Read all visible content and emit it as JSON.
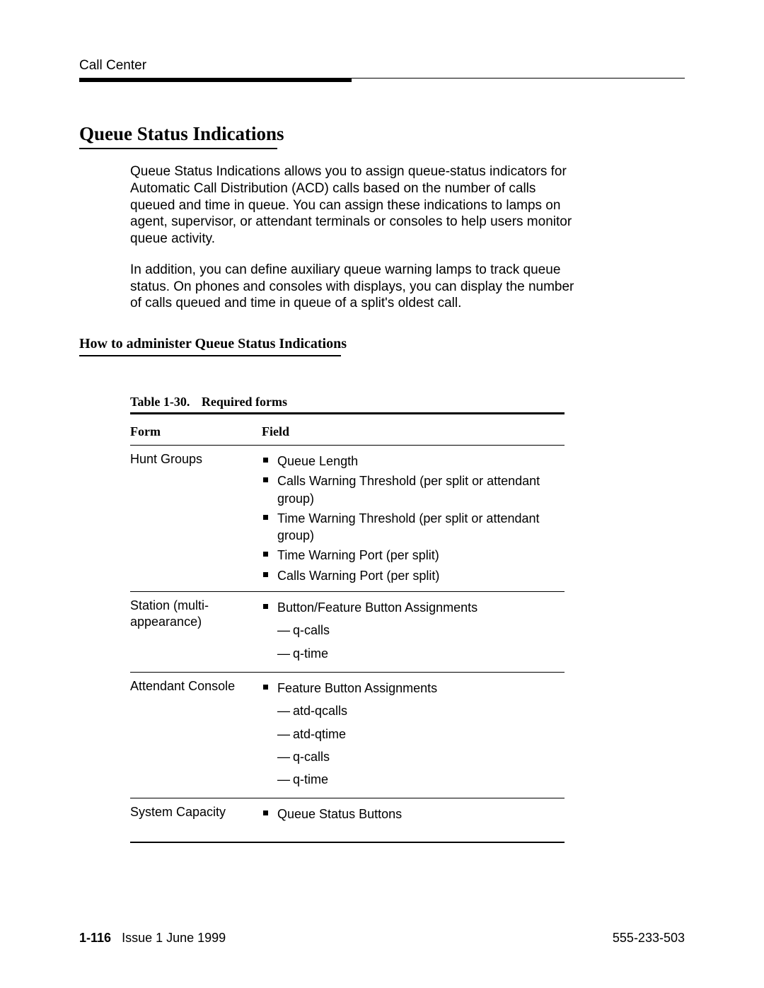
{
  "header": {
    "running": "Call Center"
  },
  "title": "Queue Status Indications",
  "paragraphs": {
    "p1": "Queue Status Indications allows you to assign queue-status indicators for Automatic Call Distribution (ACD) calls based on the number of calls queued and time in queue. You can assign these indications to lamps on agent, supervisor, or attendant terminals or consoles to help users monitor queue activity.",
    "p2": "In addition, you can define auxiliary queue warning lamps to track queue status. On phones and consoles with displays, you can display the number of calls queued and time in queue of a split's oldest call."
  },
  "subhead": "How to administer Queue Status Indications",
  "table": {
    "caption_no": "Table 1-30.",
    "caption_title": "Required forms",
    "headers": {
      "form": "Form",
      "field": "Field"
    },
    "rows": [
      {
        "form": "Hunt Groups",
        "fields": [
          {
            "text": "Queue Length"
          },
          {
            "text": "Calls Warning Threshold (per split or attendant group)"
          },
          {
            "text": "Time Warning Threshold (per split or attendant group)"
          },
          {
            "text": "Time Warning Port (per split)"
          },
          {
            "text": "Calls Warning Port (per split)"
          }
        ]
      },
      {
        "form": "Station (multi-appearance)",
        "fields": [
          {
            "text": "Button/Feature Button Assignments",
            "sub": [
              "q-calls",
              "q-time"
            ]
          }
        ]
      },
      {
        "form": "Attendant Console",
        "fields": [
          {
            "text": "Feature Button Assignments",
            "sub": [
              "atd-qcalls",
              "atd-qtime",
              "q-calls",
              "q-time"
            ]
          }
        ]
      },
      {
        "form": "System Capacity",
        "fields": [
          {
            "text": "Queue Status Buttons"
          }
        ]
      }
    ]
  },
  "footer": {
    "page_no": "1-116",
    "issue": "Issue 1 June 1999",
    "doc_no": "555-233-503"
  }
}
